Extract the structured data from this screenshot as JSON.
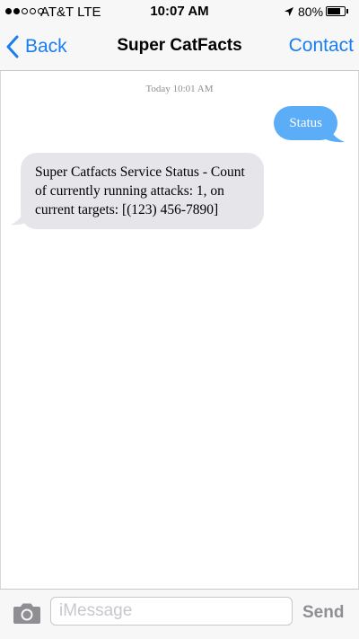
{
  "status_bar": {
    "signal_filled": 2,
    "signal_total": 5,
    "carrier": "AT&T LTE",
    "time": "10:07 AM",
    "battery_percent": "80%",
    "battery_level": 0.8,
    "icons": [
      "signal-dots-icon",
      "location-arrow-icon",
      "battery-icon"
    ]
  },
  "nav": {
    "back_label": "Back",
    "title": "Super CatFacts",
    "contact_label": "Contact",
    "accent_color": "#1a7ef0"
  },
  "thread": {
    "timestamp": "Today 10:01 AM",
    "messages": [
      {
        "direction": "outgoing",
        "text": "Status",
        "color": "#5aadf6"
      },
      {
        "direction": "incoming",
        "text": "Super Catfacts Service Status - Count of currently running attacks: 1, on current targets: [(123) 456-7890]",
        "color": "#e5e5ea"
      }
    ]
  },
  "input_bar": {
    "placeholder": "iMessage",
    "value": "",
    "send_label": "Send",
    "icons": [
      "camera-icon"
    ]
  }
}
